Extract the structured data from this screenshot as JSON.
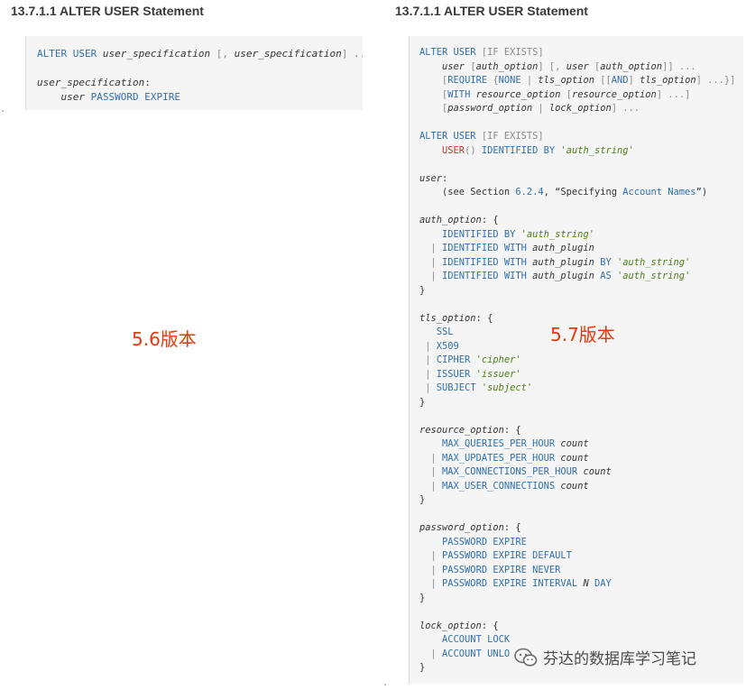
{
  "headings": {
    "left": "13.7.1.1 ALTER USER Statement",
    "right": "13.7.1.1 ALTER USER Statement"
  },
  "version_labels": {
    "left": "5.6版本",
    "right": "5.7版本"
  },
  "watermark": {
    "icon": "wechat-icon",
    "text": "芬达的数据库学习笔记"
  },
  "colors": {
    "keyword": "#2f6fae",
    "string": "#4f7d17",
    "function": "#c0392b",
    "punctuation": "#8a8a8a",
    "label": "#e8380d"
  },
  "code_left": [
    [
      [
        "keyword",
        "ALTER USER "
      ],
      [
        "var",
        "user_specification"
      ],
      [
        "punct",
        " [, "
      ],
      [
        "var",
        "user_specification"
      ],
      [
        "punct",
        "] ..."
      ]
    ],
    [],
    [
      [
        "var",
        "user_specification"
      ],
      [
        "text",
        ":"
      ]
    ],
    [
      [
        "text",
        "    "
      ],
      [
        "var",
        "user"
      ],
      [
        "text",
        " "
      ],
      [
        "keyword",
        "PASSWORD EXPIRE"
      ]
    ]
  ],
  "code_right": [
    [
      [
        "keyword",
        "ALTER USER "
      ],
      [
        "punct",
        "[IF EXISTS]"
      ]
    ],
    [
      [
        "text",
        "    "
      ],
      [
        "var",
        "user"
      ],
      [
        "punct",
        " ["
      ],
      [
        "var",
        "auth_option"
      ],
      [
        "punct",
        "] [, "
      ],
      [
        "var",
        "user"
      ],
      [
        "punct",
        " ["
      ],
      [
        "var",
        "auth_option"
      ],
      [
        "punct",
        "]] ..."
      ]
    ],
    [
      [
        "text",
        "    "
      ],
      [
        "punct",
        "["
      ],
      [
        "keyword",
        "REQUIRE"
      ],
      [
        "punct",
        " {"
      ],
      [
        "keyword",
        "NONE"
      ],
      [
        "punct",
        " | "
      ],
      [
        "var",
        "tls_option"
      ],
      [
        "punct",
        " [["
      ],
      [
        "keyword",
        "AND"
      ],
      [
        "punct",
        "] "
      ],
      [
        "var",
        "tls_option"
      ],
      [
        "punct",
        "] ...}]"
      ]
    ],
    [
      [
        "text",
        "    "
      ],
      [
        "punct",
        "["
      ],
      [
        "keyword",
        "WITH"
      ],
      [
        "text",
        " "
      ],
      [
        "var",
        "resource_option"
      ],
      [
        "punct",
        " ["
      ],
      [
        "var",
        "resource_option"
      ],
      [
        "punct",
        "] ...]"
      ]
    ],
    [
      [
        "text",
        "    "
      ],
      [
        "punct",
        "["
      ],
      [
        "var",
        "password_option"
      ],
      [
        "punct",
        " | "
      ],
      [
        "var",
        "lock_option"
      ],
      [
        "punct",
        "] ..."
      ]
    ],
    [],
    [
      [
        "keyword",
        "ALTER USER "
      ],
      [
        "punct",
        "[IF EXISTS]"
      ]
    ],
    [
      [
        "text",
        "    "
      ],
      [
        "func",
        "USER"
      ],
      [
        "punct",
        "() "
      ],
      [
        "keyword",
        "IDENTIFIED BY "
      ],
      [
        "string",
        "'auth_string'"
      ]
    ],
    [],
    [
      [
        "var",
        "user"
      ],
      [
        "text",
        ":"
      ]
    ],
    [
      [
        "text",
        "    (see Section "
      ],
      [
        "num",
        "6.2.4"
      ],
      [
        "text",
        ", “Specifying "
      ],
      [
        "keyword",
        "Account Names"
      ],
      [
        "text",
        "”)"
      ]
    ],
    [],
    [
      [
        "var",
        "auth_option"
      ],
      [
        "text",
        ": {"
      ]
    ],
    [
      [
        "text",
        "    "
      ],
      [
        "keyword",
        "IDENTIFIED BY "
      ],
      [
        "string",
        "'auth_string'"
      ]
    ],
    [
      [
        "text",
        "  "
      ],
      [
        "punct",
        "| "
      ],
      [
        "keyword",
        "IDENTIFIED WITH "
      ],
      [
        "var",
        "auth_plugin"
      ]
    ],
    [
      [
        "text",
        "  "
      ],
      [
        "punct",
        "| "
      ],
      [
        "keyword",
        "IDENTIFIED WITH "
      ],
      [
        "var",
        "auth_plugin"
      ],
      [
        "keyword",
        " BY "
      ],
      [
        "string",
        "'auth_string'"
      ]
    ],
    [
      [
        "text",
        "  "
      ],
      [
        "punct",
        "| "
      ],
      [
        "keyword",
        "IDENTIFIED WITH "
      ],
      [
        "var",
        "auth_plugin"
      ],
      [
        "keyword",
        " AS "
      ],
      [
        "string",
        "'auth_string'"
      ]
    ],
    [
      [
        "text",
        "}"
      ]
    ],
    [],
    [
      [
        "var",
        "tls_option"
      ],
      [
        "text",
        ": {"
      ]
    ],
    [
      [
        "text",
        "   "
      ],
      [
        "keyword",
        "SSL"
      ]
    ],
    [
      [
        "text",
        " "
      ],
      [
        "punct",
        "| "
      ],
      [
        "keyword",
        "X509"
      ]
    ],
    [
      [
        "text",
        " "
      ],
      [
        "punct",
        "| "
      ],
      [
        "keyword",
        "CIPHER "
      ],
      [
        "string",
        "'cipher'"
      ]
    ],
    [
      [
        "text",
        " "
      ],
      [
        "punct",
        "| "
      ],
      [
        "keyword",
        "ISSUER "
      ],
      [
        "string",
        "'issuer'"
      ]
    ],
    [
      [
        "text",
        " "
      ],
      [
        "punct",
        "| "
      ],
      [
        "keyword",
        "SUBJECT "
      ],
      [
        "string",
        "'subject'"
      ]
    ],
    [
      [
        "text",
        "}"
      ]
    ],
    [],
    [
      [
        "var",
        "resource_option"
      ],
      [
        "text",
        ": {"
      ]
    ],
    [
      [
        "text",
        "    "
      ],
      [
        "keyword",
        "MAX_QUERIES_PER_HOUR "
      ],
      [
        "var",
        "count"
      ]
    ],
    [
      [
        "text",
        "  "
      ],
      [
        "punct",
        "| "
      ],
      [
        "keyword",
        "MAX_UPDATES_PER_HOUR "
      ],
      [
        "var",
        "count"
      ]
    ],
    [
      [
        "text",
        "  "
      ],
      [
        "punct",
        "| "
      ],
      [
        "keyword",
        "MAX_CONNECTIONS_PER_HOUR "
      ],
      [
        "var",
        "count"
      ]
    ],
    [
      [
        "text",
        "  "
      ],
      [
        "punct",
        "| "
      ],
      [
        "keyword",
        "MAX_USER_CONNECTIONS "
      ],
      [
        "var",
        "count"
      ]
    ],
    [
      [
        "text",
        "}"
      ]
    ],
    [],
    [
      [
        "var",
        "password_option"
      ],
      [
        "text",
        ": {"
      ]
    ],
    [
      [
        "text",
        "    "
      ],
      [
        "keyword",
        "PASSWORD EXPIRE"
      ]
    ],
    [
      [
        "text",
        "  "
      ],
      [
        "punct",
        "| "
      ],
      [
        "keyword",
        "PASSWORD EXPIRE DEFAULT"
      ]
    ],
    [
      [
        "text",
        "  "
      ],
      [
        "punct",
        "| "
      ],
      [
        "keyword",
        "PASSWORD EXPIRE NEVER"
      ]
    ],
    [
      [
        "text",
        "  "
      ],
      [
        "punct",
        "| "
      ],
      [
        "keyword",
        "PASSWORD EXPIRE INTERVAL "
      ],
      [
        "var",
        "N"
      ],
      [
        "keyword",
        " DAY"
      ]
    ],
    [
      [
        "text",
        "}"
      ]
    ],
    [],
    [
      [
        "var",
        "lock_option"
      ],
      [
        "text",
        ": {"
      ]
    ],
    [
      [
        "text",
        "    "
      ],
      [
        "keyword",
        "ACCOUNT LOCK"
      ]
    ],
    [
      [
        "text",
        "  "
      ],
      [
        "punct",
        "| "
      ],
      [
        "keyword",
        "ACCOUNT UNLO"
      ]
    ],
    [
      [
        "text",
        "}"
      ]
    ]
  ]
}
